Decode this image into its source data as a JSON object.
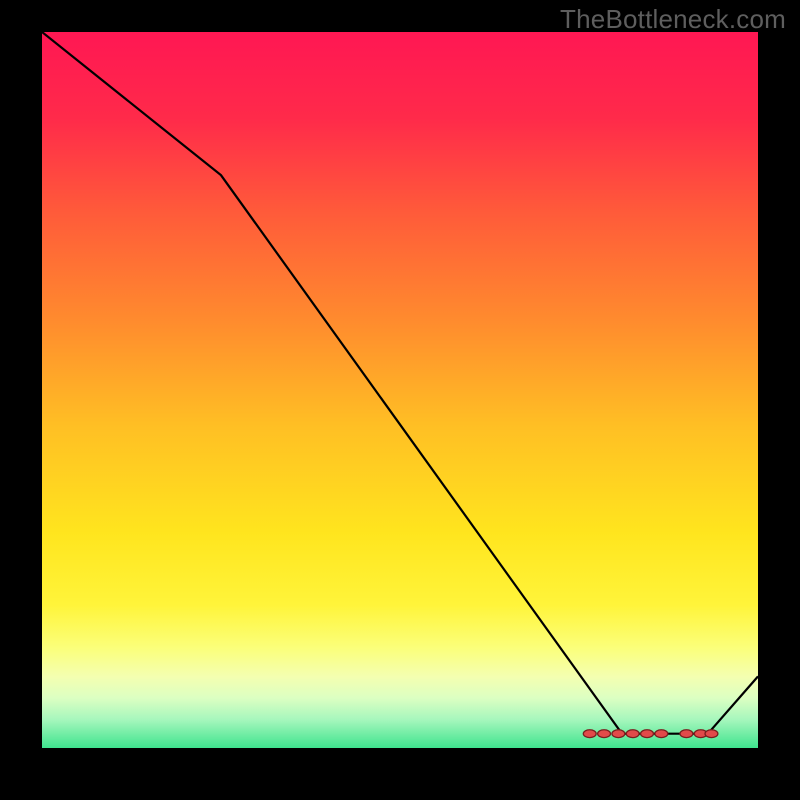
{
  "watermark": "TheBottleneck.com",
  "colors": {
    "background": "#000000",
    "line": "#000000",
    "dot_fill": "#e24a4a",
    "dot_stroke": "#7a1f1f"
  },
  "gradient_stops": [
    {
      "pct": 0,
      "color": "#ff1753"
    },
    {
      "pct": 12,
      "color": "#ff2a4a"
    },
    {
      "pct": 25,
      "color": "#ff5a3a"
    },
    {
      "pct": 40,
      "color": "#ff8a2e"
    },
    {
      "pct": 55,
      "color": "#ffbf24"
    },
    {
      "pct": 70,
      "color": "#ffe51e"
    },
    {
      "pct": 80,
      "color": "#fff43a"
    },
    {
      "pct": 86,
      "color": "#fbff7a"
    },
    {
      "pct": 90,
      "color": "#f4ffb0"
    },
    {
      "pct": 93,
      "color": "#dcffc2"
    },
    {
      "pct": 96,
      "color": "#a7f7bd"
    },
    {
      "pct": 100,
      "color": "#3fe38e"
    }
  ],
  "chart_data": {
    "type": "line",
    "title": "",
    "xlabel": "",
    "ylabel": "",
    "xlim": [
      0,
      100
    ],
    "ylim": [
      0,
      100
    ],
    "x": [
      0,
      25,
      81,
      93,
      100
    ],
    "values": [
      100,
      80,
      2,
      2,
      10
    ],
    "trough_region": {
      "x_start": 75,
      "x_end": 94,
      "y": 2
    },
    "dots": [
      {
        "x": 76.5,
        "y": 2
      },
      {
        "x": 78.5,
        "y": 2
      },
      {
        "x": 80.5,
        "y": 2
      },
      {
        "x": 82.5,
        "y": 2
      },
      {
        "x": 84.5,
        "y": 2
      },
      {
        "x": 86.5,
        "y": 2
      },
      {
        "x": 90.0,
        "y": 2
      },
      {
        "x": 92.0,
        "y": 2
      },
      {
        "x": 93.5,
        "y": 2
      }
    ]
  }
}
